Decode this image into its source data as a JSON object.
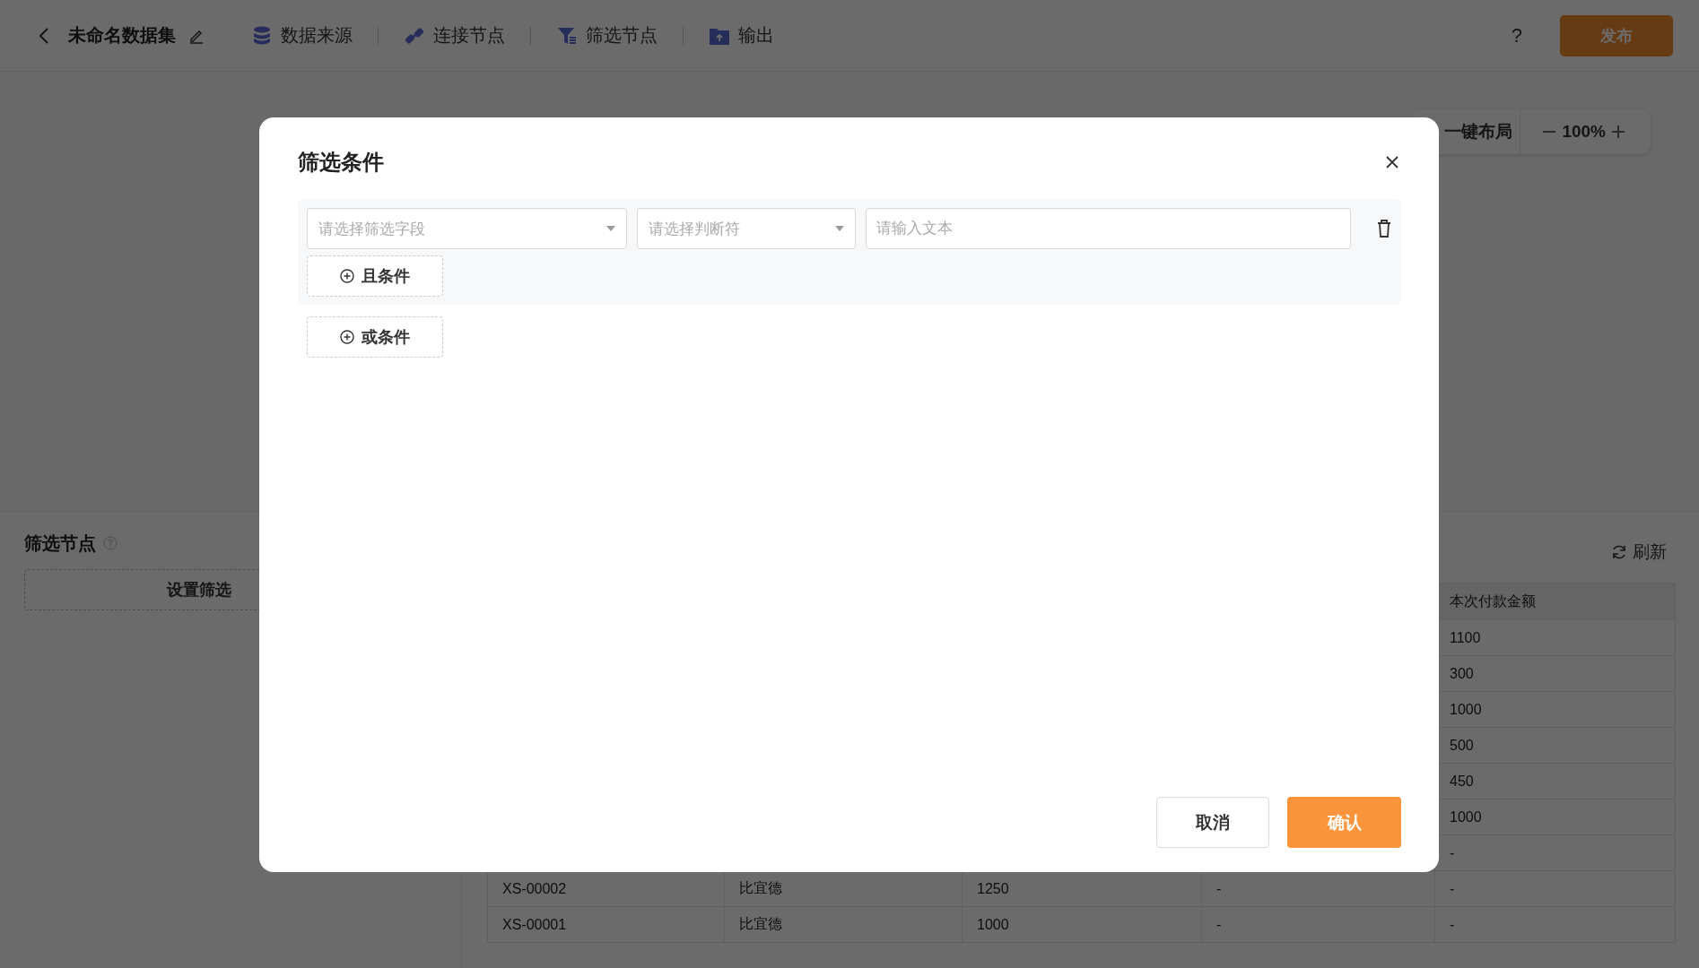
{
  "topbar": {
    "title": "未命名数据集",
    "nav": [
      {
        "label": "数据来源"
      },
      {
        "label": "连接节点"
      },
      {
        "label": "筛选节点"
      },
      {
        "label": "输出"
      }
    ],
    "help": "?",
    "publish": "发布"
  },
  "canvas_toolbar": {
    "auto_layout": "一键布局",
    "zoom": "100%"
  },
  "filter_panel": {
    "title": "筛选节点",
    "set_button": "设置筛选"
  },
  "preview": {
    "refresh": "刷新",
    "column_5_header": "本次付款金额",
    "rows": [
      {
        "column_5": "1100"
      },
      {
        "column_5": "300"
      },
      {
        "column_5": "1000"
      },
      {
        "column_5": "500"
      },
      {
        "column_5": "450"
      },
      {
        "column_5": "1000"
      },
      {
        "column_5": "-"
      },
      {
        "column_1": "XS-00002",
        "column_2": "比宜德",
        "column_3": "1250",
        "column_4": "-",
        "column_5": "-"
      },
      {
        "column_1": "XS-00001",
        "column_2": "比宜德",
        "column_3": "1000",
        "column_4": "-",
        "column_5": "-"
      }
    ]
  },
  "dialog": {
    "title": "筛选条件",
    "condition_groups": [
      {
        "conditions": [
          {
            "field": {
              "placeholder": "请选择筛选字段"
            },
            "operator": {
              "placeholder": "请选择判断符"
            },
            "value": {
              "placeholder": "请输入文本"
            }
          }
        ],
        "and_button": "且条件"
      }
    ],
    "or_button": "或条件",
    "cancel": "取消",
    "confirm": "确认"
  }
}
